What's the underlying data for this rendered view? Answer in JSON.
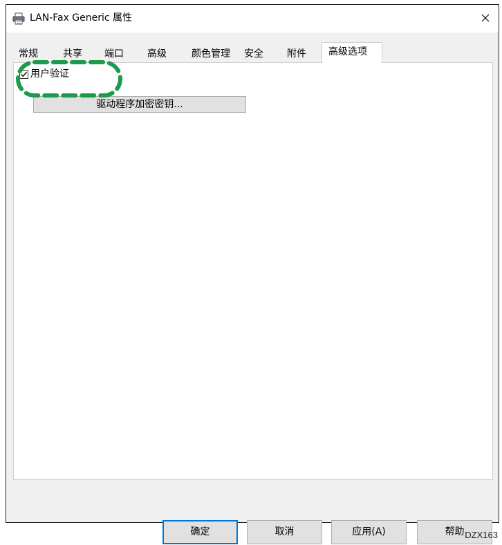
{
  "window": {
    "title": "LAN-Fax Generic 属性",
    "icon": "printer-icon",
    "close_glyph": "✕"
  },
  "tabs": [
    {
      "label": "常规",
      "active": false
    },
    {
      "label": "共享",
      "active": false
    },
    {
      "label": "端口",
      "active": false
    },
    {
      "label": "高级",
      "active": false
    },
    {
      "label": "颜色管理",
      "active": false
    },
    {
      "label": "安全",
      "active": false
    },
    {
      "label": "附件",
      "active": false
    },
    {
      "label": "高级选项",
      "active": true
    }
  ],
  "panel": {
    "user_auth": {
      "label": "用户验证",
      "checked": true
    },
    "encryption_button": "驱动程序加密密钥..."
  },
  "buttons": {
    "ok": "确定",
    "cancel": "取消",
    "apply": "应用(A)",
    "help": "帮助"
  },
  "caption": "DZX163",
  "colors": {
    "highlight": "#1e9a4a",
    "default_button_border": "#0078d7",
    "dialog_background": "#f0f0f0"
  }
}
